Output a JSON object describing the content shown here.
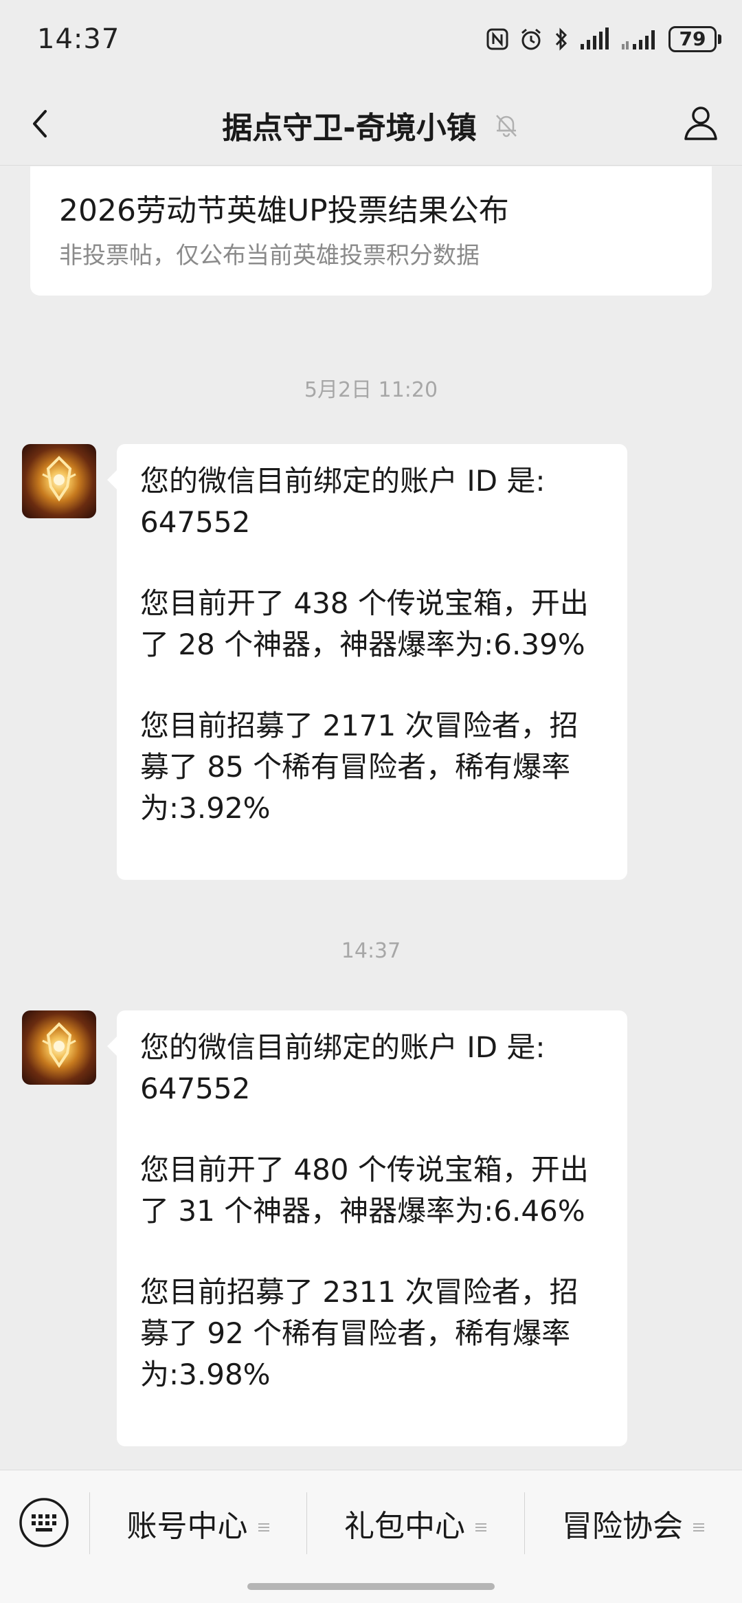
{
  "status_bar": {
    "time": "14:37",
    "battery": "79",
    "icons": [
      "nfc-icon",
      "alarm-icon",
      "bluetooth-icon",
      "signal-icon",
      "signal-2-icon",
      "battery-icon"
    ]
  },
  "nav": {
    "title": "据点守卫-奇境小镇",
    "icons": [
      "back-icon",
      "mute-bell-icon",
      "profile-icon"
    ]
  },
  "article": {
    "title": "2026劳动节英雄UP投票结果公布",
    "desc": "非投票帖，仅公布当前英雄投票积分数据"
  },
  "messages": [
    {
      "timestamp": "5月2日 11:20",
      "line1": "您的微信目前绑定的账户 ID 是:",
      "line2": "647552",
      "para2_line1": "您目前开了 438 个传说宝箱，开出",
      "para2_line2": "了 28 个神器，神器爆率为:6.39%",
      "para3_line1": "您目前招募了 2171 次冒险者，招",
      "para3_line2": "募了 85 个稀有冒险者，稀有爆率",
      "para3_line3": "为:3.92%"
    },
    {
      "timestamp": "14:37",
      "line1": "您的微信目前绑定的账户 ID 是:",
      "line2": "647552",
      "para2_line1": "您目前开了 480 个传说宝箱，开出",
      "para2_line2": "了 31 个神器，神器爆率为:6.46%",
      "para3_line1": "您目前招募了 2311 次冒险者，招",
      "para3_line2": "募了 92 个稀有冒险者，稀有爆率",
      "para3_line3": "为:3.98%"
    }
  ],
  "bottom_menu": {
    "items": [
      {
        "label": "账号中心"
      },
      {
        "label": "礼包中心"
      },
      {
        "label": "冒险协会"
      }
    ],
    "icons": [
      "keyboard-icon",
      "menu-lines-icon"
    ]
  }
}
